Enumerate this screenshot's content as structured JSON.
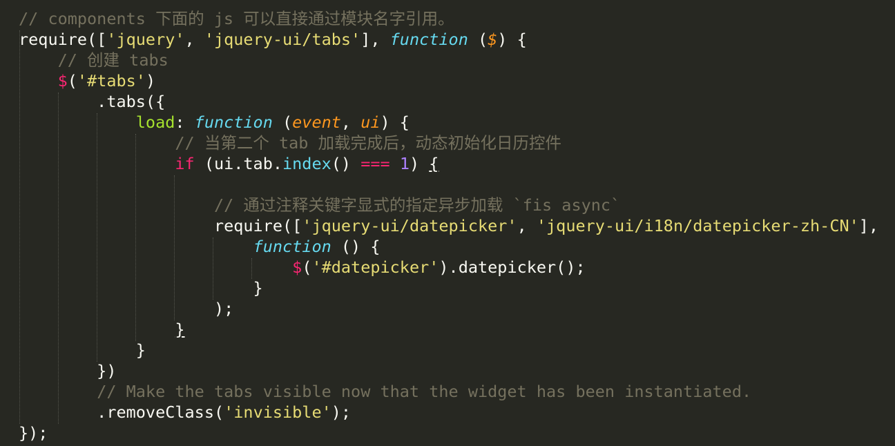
{
  "editor": {
    "theme_colors": {
      "background": "#272822",
      "text": "#f8f8f2",
      "comment": "#75715e",
      "string": "#e6db74",
      "keyword": "#f92672",
      "function": "#66d9ef",
      "property": "#a6e22e",
      "parameter": "#fd971f",
      "number": "#ae81ff"
    },
    "lines": [
      [
        {
          "t": "// components 下面的 js 可以直接通过模块名字引用。",
          "c": "c-com"
        }
      ],
      [
        {
          "t": "require([",
          "c": "c-pl"
        },
        {
          "t": "'jquery'",
          "c": "c-str"
        },
        {
          "t": ", ",
          "c": "c-pl"
        },
        {
          "t": "'jquery-ui/tabs'",
          "c": "c-str"
        },
        {
          "t": "], ",
          "c": "c-pl"
        },
        {
          "t": "function",
          "c": "c-fn"
        },
        {
          "t": " (",
          "c": "c-pl"
        },
        {
          "t": "$",
          "c": "c-par"
        },
        {
          "t": ") {",
          "c": "c-pl"
        }
      ],
      [
        {
          "t": "    ",
          "c": "c-pl"
        },
        {
          "t": "// 创建 tabs",
          "c": "c-com"
        }
      ],
      [
        {
          "t": "    ",
          "c": "c-pl"
        },
        {
          "t": "$",
          "c": "c-dol"
        },
        {
          "t": "(",
          "c": "c-pl"
        },
        {
          "t": "'#tabs'",
          "c": "c-str"
        },
        {
          "t": ")",
          "c": "c-pl"
        }
      ],
      [
        {
          "t": "        .tabs({",
          "c": "c-pl"
        }
      ],
      [
        {
          "t": "            ",
          "c": "c-pl"
        },
        {
          "t": "load",
          "c": "c-key"
        },
        {
          "t": ": ",
          "c": "c-pl"
        },
        {
          "t": "function",
          "c": "c-fn"
        },
        {
          "t": " (",
          "c": "c-pl"
        },
        {
          "t": "event",
          "c": "c-par"
        },
        {
          "t": ", ",
          "c": "c-pl"
        },
        {
          "t": "ui",
          "c": "c-par"
        },
        {
          "t": ") {",
          "c": "c-pl"
        }
      ],
      [
        {
          "t": "                ",
          "c": "c-pl"
        },
        {
          "t": "// 当第二个 tab 加载完成后，动态初始化日历控件",
          "c": "c-com"
        }
      ],
      [
        {
          "t": "                ",
          "c": "c-pl"
        },
        {
          "t": "if",
          "c": "c-kw"
        },
        {
          "t": " (ui.tab.",
          "c": "c-pl"
        },
        {
          "t": "index",
          "c": "c-fn2"
        },
        {
          "t": "() ",
          "c": "c-pl"
        },
        {
          "t": "===",
          "c": "c-kw"
        },
        {
          "t": " ",
          "c": "c-pl"
        },
        {
          "t": "1",
          "c": "c-num"
        },
        {
          "t": ") ",
          "c": "c-pl"
        },
        {
          "t": "{",
          "c": "c-pl u"
        }
      ],
      [
        {
          "t": "",
          "c": "c-pl"
        }
      ],
      [
        {
          "t": "                    ",
          "c": "c-pl"
        },
        {
          "t": "// 通过注释关键字显式的指定异步加载 `fis async`",
          "c": "c-com"
        }
      ],
      [
        {
          "t": "                    require([",
          "c": "c-pl"
        },
        {
          "t": "'jquery-ui/datepicker'",
          "c": "c-str"
        },
        {
          "t": ", ",
          "c": "c-pl"
        },
        {
          "t": "'jquery-ui/i18n/datepicker-zh-CN'",
          "c": "c-str"
        },
        {
          "t": "],",
          "c": "c-pl"
        }
      ],
      [
        {
          "t": "                        ",
          "c": "c-pl"
        },
        {
          "t": "function",
          "c": "c-fn"
        },
        {
          "t": " () {",
          "c": "c-pl"
        }
      ],
      [
        {
          "t": "                            ",
          "c": "c-pl"
        },
        {
          "t": "$",
          "c": "c-dol"
        },
        {
          "t": "(",
          "c": "c-pl"
        },
        {
          "t": "'#datepicker'",
          "c": "c-str"
        },
        {
          "t": ").datepicker();",
          "c": "c-pl"
        }
      ],
      [
        {
          "t": "                        }",
          "c": "c-pl"
        }
      ],
      [
        {
          "t": "                    );",
          "c": "c-pl"
        }
      ],
      [
        {
          "t": "                ",
          "c": "c-pl"
        },
        {
          "t": "}",
          "c": "c-pl u"
        }
      ],
      [
        {
          "t": "            }",
          "c": "c-pl"
        }
      ],
      [
        {
          "t": "        })",
          "c": "c-pl"
        }
      ],
      [
        {
          "t": "        ",
          "c": "c-pl"
        },
        {
          "t": "// Make the tabs visible now that the widget has been instantiated.",
          "c": "c-com"
        }
      ],
      [
        {
          "t": "        .removeClass(",
          "c": "c-pl"
        },
        {
          "t": "'invisible'",
          "c": "c-str"
        },
        {
          "t": ");",
          "c": "c-pl"
        }
      ],
      [
        {
          "t": "});",
          "c": "c-pl"
        }
      ]
    ]
  }
}
